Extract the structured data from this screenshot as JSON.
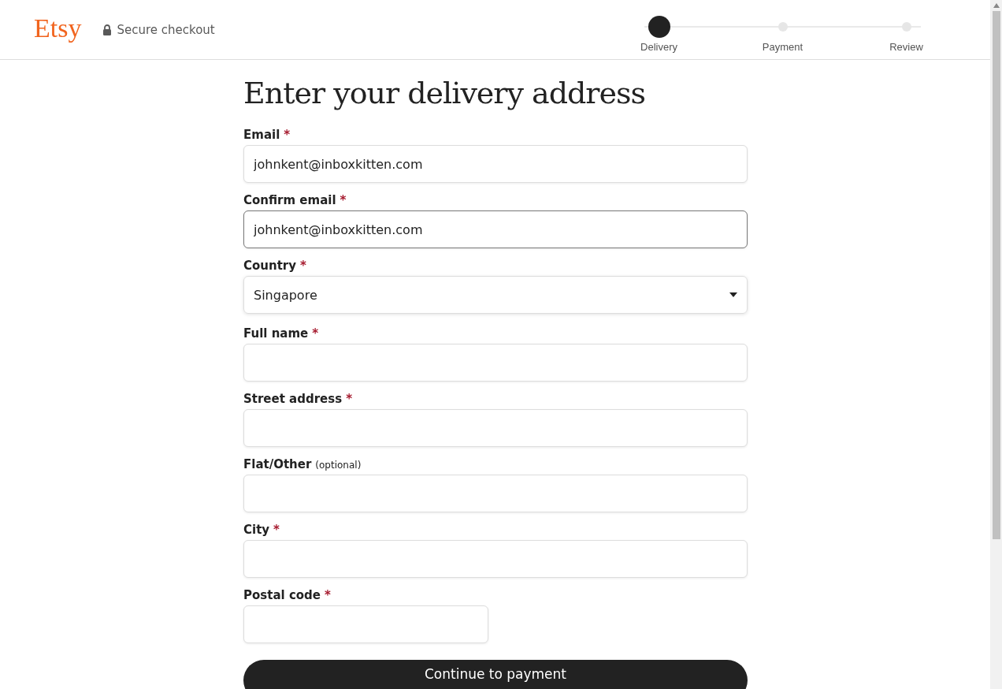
{
  "header": {
    "logo": "Etsy",
    "secure_label": "Secure checkout"
  },
  "steps": [
    {
      "label": "Delivery",
      "selected": true
    },
    {
      "label": "Payment",
      "selected": false
    },
    {
      "label": "Review",
      "selected": false
    }
  ],
  "title": "Enter your delivery address",
  "fields": [
    {
      "kind": "text",
      "label": "Email",
      "required_mark": "*",
      "value": "johnkent@inboxkitten.com",
      "focused": false
    },
    {
      "kind": "text",
      "label": "Confirm email",
      "required_mark": "*",
      "value": "johnkent@inboxkitten.com",
      "focused": true
    },
    {
      "kind": "select",
      "label": "Country",
      "required_mark": "*",
      "value": "Singapore",
      "focused": false
    },
    {
      "kind": "text",
      "label": "Full name",
      "required_mark": "*",
      "focused": false
    },
    {
      "kind": "text",
      "label": "Street address",
      "required_mark": "*",
      "focused": false
    },
    {
      "kind": "text",
      "label": "Flat/Other",
      "note": "(optional)",
      "focused": false
    },
    {
      "kind": "text",
      "label": "City",
      "required_mark": "*",
      "focused": false
    },
    {
      "kind": "short",
      "label": "Postal code",
      "required_mark": "*",
      "focused": false
    }
  ],
  "submit": "Continue to payment"
}
